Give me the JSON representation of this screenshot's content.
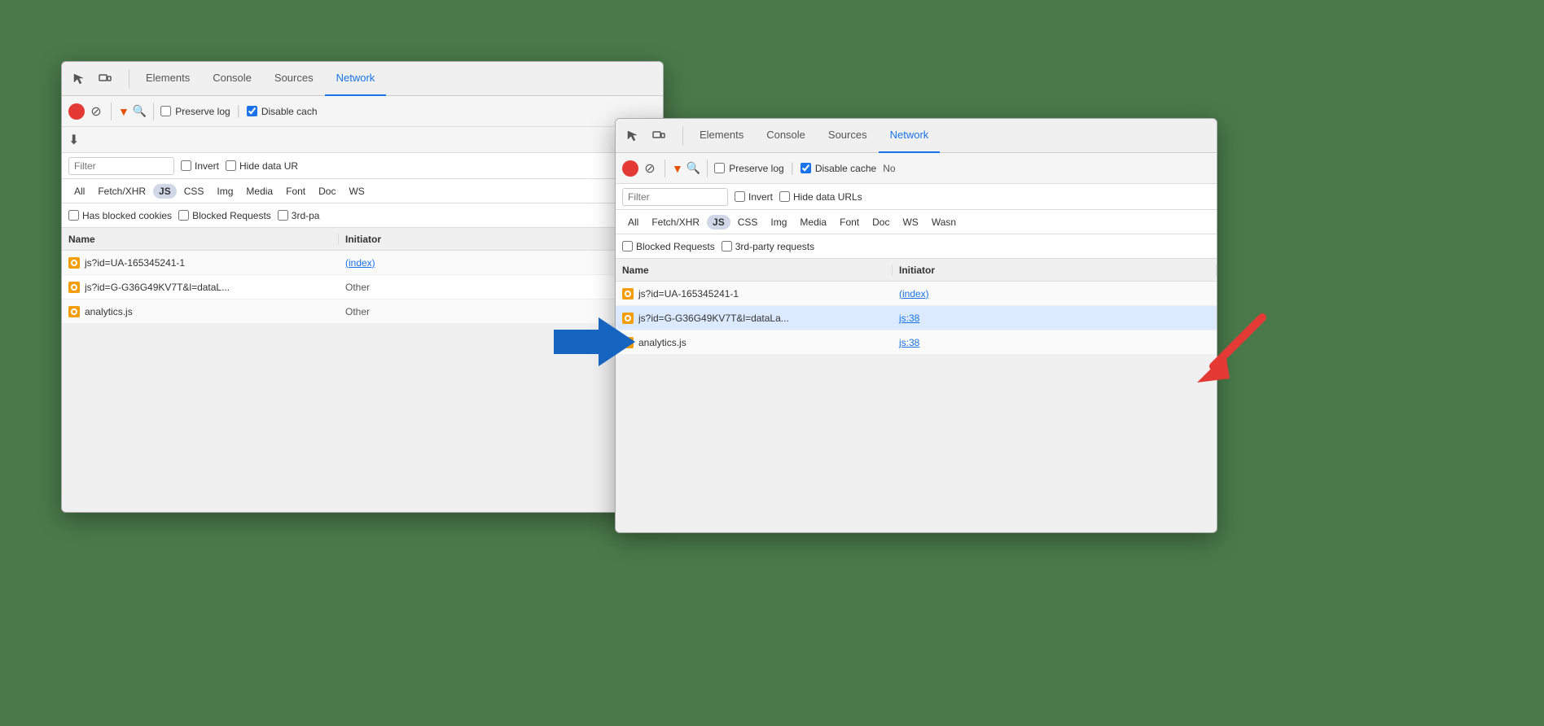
{
  "window1": {
    "tabs": [
      {
        "label": "Elements",
        "active": false
      },
      {
        "label": "Console",
        "active": false
      },
      {
        "label": "Sources",
        "active": false
      },
      {
        "label": "Network",
        "active": true
      }
    ],
    "toolbar": {
      "preserve_log_label": "Preserve log",
      "disable_cache_label": "Disable cach",
      "preserve_log_checked": false,
      "disable_cache_checked": true
    },
    "filter": {
      "placeholder": "Filter",
      "invert_label": "Invert",
      "hide_data_urls_label": "Hide data UR"
    },
    "type_filters": [
      "All",
      "Fetch/XHR",
      "JS",
      "CSS",
      "Img",
      "Media",
      "Font",
      "Doc",
      "WS"
    ],
    "js_active": true,
    "blocked_bar": {
      "has_blocked_cookies": "Has blocked cookies",
      "blocked_requests": "Blocked Requests",
      "third_party": "3rd-pa"
    },
    "table": {
      "col_name": "Name",
      "col_initiator": "Initiator",
      "rows": [
        {
          "name": "js?id=UA-165345241-1",
          "initiator": "(index)",
          "initiator_link": true
        },
        {
          "name": "js?id=G-G36G49KV7T&l=dataL...",
          "initiator": "Other",
          "initiator_link": false
        },
        {
          "name": "analytics.js",
          "initiator": "Other",
          "initiator_link": false
        }
      ]
    }
  },
  "window2": {
    "tabs": [
      {
        "label": "Elements",
        "active": false
      },
      {
        "label": "Console",
        "active": false
      },
      {
        "label": "Sources",
        "active": false
      },
      {
        "label": "Network",
        "active": true
      }
    ],
    "toolbar": {
      "preserve_log_label": "Preserve log",
      "disable_cache_label": "Disable cache",
      "no_throttle_label": "No",
      "preserve_log_checked": false,
      "disable_cache_checked": true
    },
    "filter": {
      "placeholder": "Filter",
      "invert_label": "Invert",
      "hide_data_urls_label": "Hide data URLs"
    },
    "type_filters": [
      "All",
      "Fetch/XHR",
      "JS",
      "CSS",
      "Img",
      "Media",
      "Font",
      "Doc",
      "WS",
      "Wasn"
    ],
    "js_active": true,
    "blocked_bar": {
      "blocked_requests": "Blocked Requests",
      "third_party": "3rd-party requests"
    },
    "table": {
      "col_name": "Name",
      "col_initiator": "Initiator",
      "rows": [
        {
          "name": "js?id=UA-165345241-1",
          "initiator": "(index)",
          "initiator_link": true
        },
        {
          "name": "js?id=G-G36G49KV7T&l=dataLa...",
          "initiator": "js:38",
          "initiator_link": true,
          "highlighted": true
        },
        {
          "name": "analytics.js",
          "initiator": "js:38",
          "initiator_link": true
        }
      ]
    }
  },
  "annotations": {
    "blue_arrow_text": "➤",
    "red_arrow_visible": true
  }
}
